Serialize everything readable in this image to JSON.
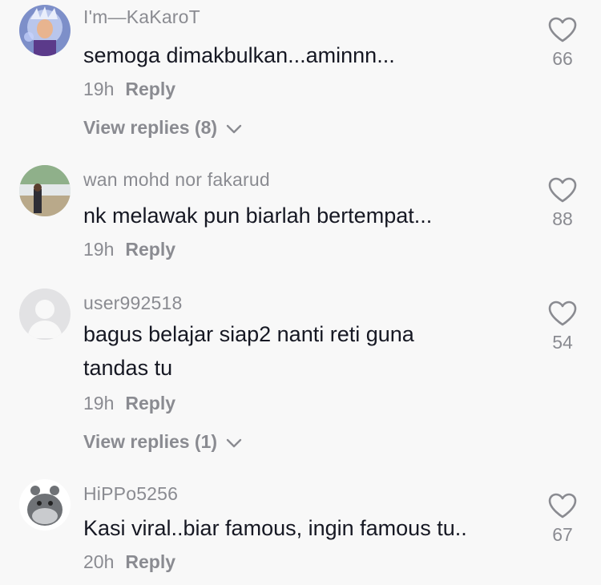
{
  "comments": [
    {
      "username": "I'm—KaKaroT",
      "text": "semoga dimakbulkan...aminnn...",
      "time": "19h",
      "reply_label": "Reply",
      "view_replies": "View replies (8)",
      "likes": "66",
      "avatar": "avatar-anime-character"
    },
    {
      "username": "wan mohd nor fakarud",
      "text": "nk melawak pun biarlah bertempat...",
      "time": "19h",
      "reply_label": "Reply",
      "likes": "88",
      "avatar": "avatar-photo-person-outdoors"
    },
    {
      "username": "user992518",
      "text": "bagus belajar siap2 nanti reti guna tandas tu",
      "time": "19h",
      "reply_label": "Reply",
      "view_replies": "View replies (1)",
      "likes": "54",
      "avatar": "avatar-default-placeholder"
    },
    {
      "username": "HiPPo5256",
      "text": "Kasi viral..biar famous, ingin famous tu..",
      "time": "20h",
      "reply_label": "Reply",
      "likes": "67",
      "avatar": "avatar-cartoon-hippo"
    }
  ],
  "colors": {
    "background": "#f8f8f8",
    "text_primary": "#161823",
    "text_secondary": "#8a8b91"
  },
  "icons": {
    "like": "heart-outline-icon",
    "expand": "chevron-down-icon"
  }
}
